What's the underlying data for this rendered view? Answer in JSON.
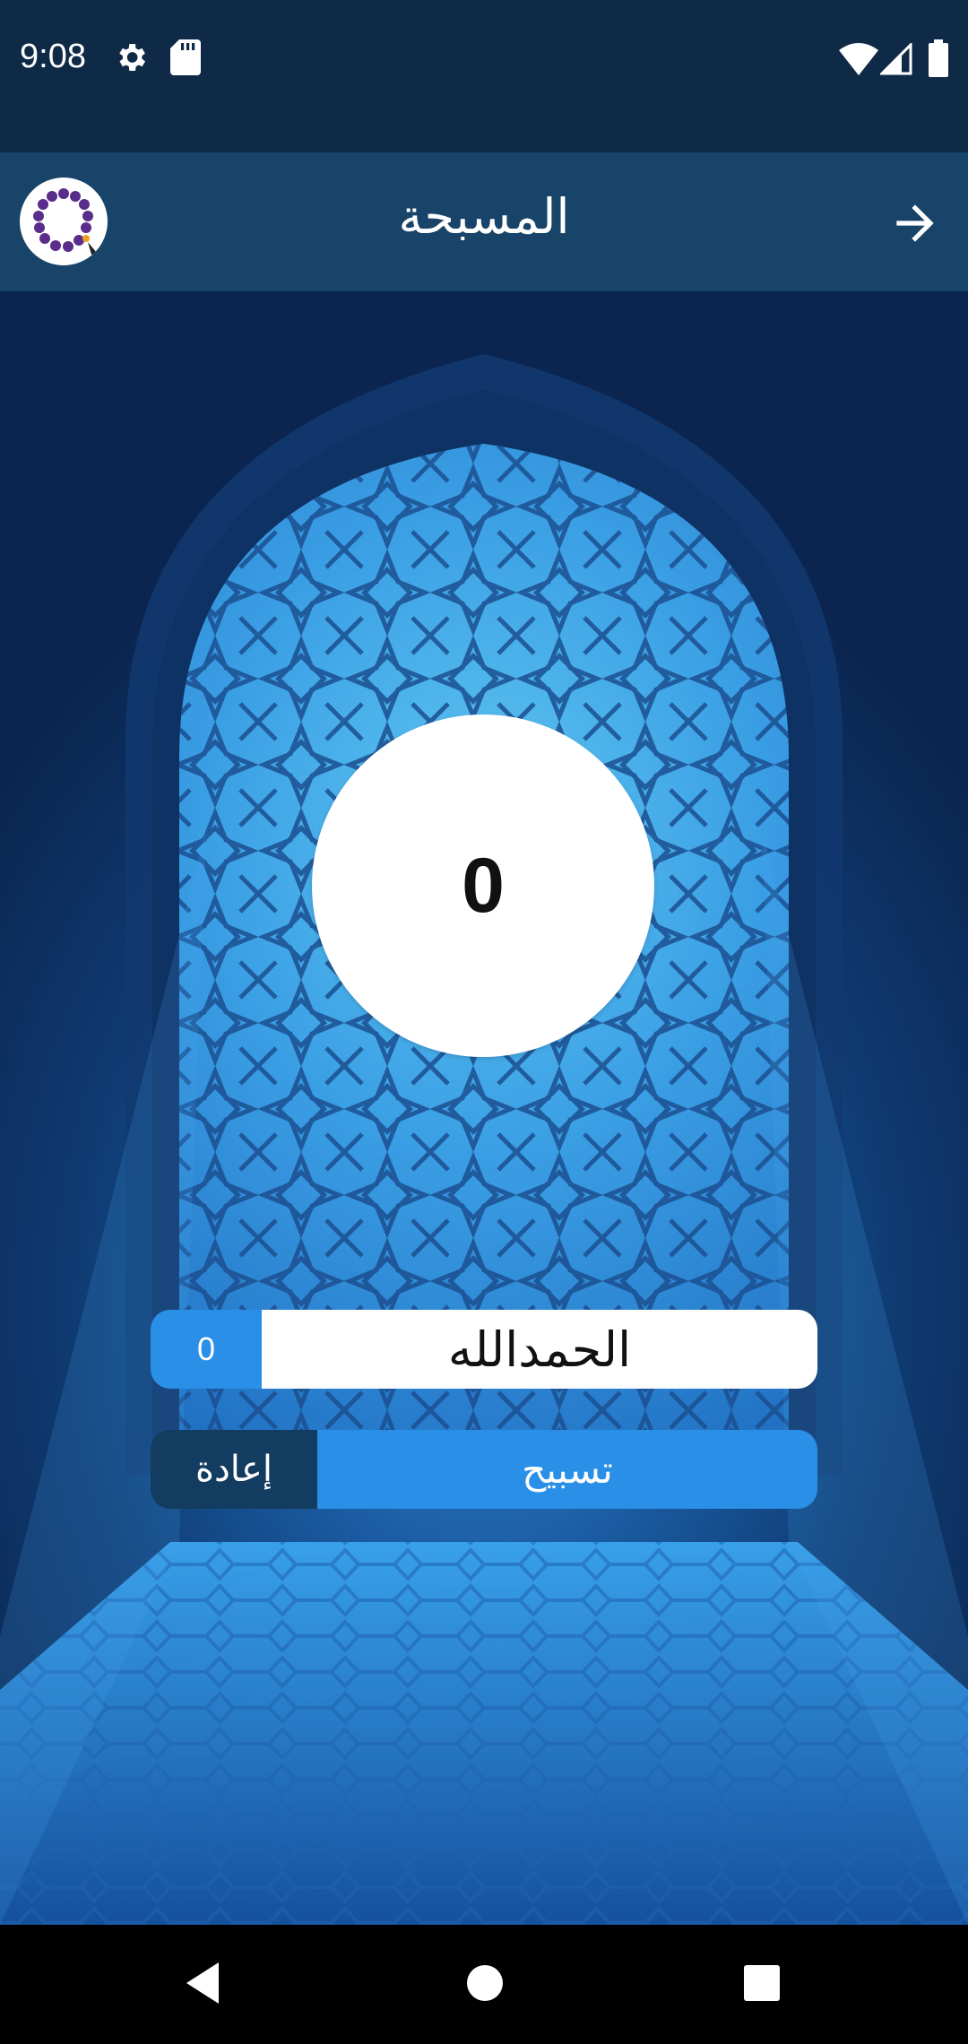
{
  "status_bar": {
    "time": "9:08",
    "icons": [
      "settings-icon",
      "sd-card-icon",
      "wifi-icon",
      "signal-icon",
      "battery-icon"
    ]
  },
  "app_bar": {
    "title": "المسبحة",
    "logo_icon": "prayer-beads-icon",
    "back_icon": "arrow-forward-icon"
  },
  "counter": {
    "value": "0"
  },
  "dhikr": {
    "count": "0",
    "text": "الحمدالله"
  },
  "buttons": {
    "reset_label": "إعادة",
    "tasbih_label": "تسبيح"
  },
  "nav_bar": {
    "icons": [
      "back-triangle-icon",
      "home-circle-icon",
      "recents-square-icon"
    ]
  },
  "colors": {
    "status_bar": "#0e2a47",
    "app_bar": "#174468",
    "accent_blue": "#2a8fe6",
    "reset_dark": "#123c60"
  }
}
